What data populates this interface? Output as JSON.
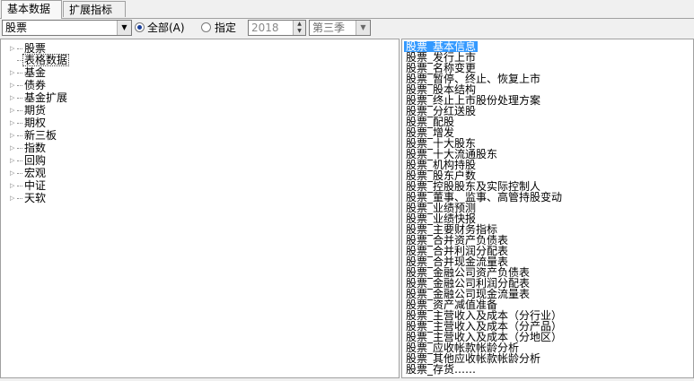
{
  "tabs": [
    {
      "label": "基本数据",
      "active": true
    },
    {
      "label": "扩展指标",
      "active": false
    }
  ],
  "toolbar": {
    "type_value": "股票",
    "radio_all_label": "全部(A)",
    "radio_spec_label": "指定",
    "year_value": "2018",
    "season_value": "第三季"
  },
  "tree": {
    "items": [
      {
        "label": "股票"
      },
      {
        "label": "表格数据",
        "selected": true
      },
      {
        "label": "基金"
      },
      {
        "label": "债券"
      },
      {
        "label": "基金扩展"
      },
      {
        "label": "期货"
      },
      {
        "label": "期权"
      },
      {
        "label": "新三板"
      },
      {
        "label": "指数"
      },
      {
        "label": "回购"
      },
      {
        "label": "宏观"
      },
      {
        "label": "中证"
      },
      {
        "label": "天软"
      }
    ]
  },
  "list": {
    "items": [
      "股票_基本信息",
      "股票_发行上市",
      "股票_名称变更",
      "股票_暂停、终止、恢复上市",
      "股票_股本结构",
      "股票_终止上市股份处理方案",
      "股票_分红送股",
      "股票_配股",
      "股票_增发",
      "股票_十大股东",
      "股票_十大流通股东",
      "股票_机构持股",
      "股票_股东户数",
      "股票_控股股东及实际控制人",
      "股票_董事、监事、高管持股变动",
      "股票_业绩预测",
      "股票_业绩快报",
      "股票_主要财务指标",
      "股票_合并资产负债表",
      "股票_合并利润分配表",
      "股票_合并现金流量表",
      "股票_金融公司资产负债表",
      "股票_金融公司利润分配表",
      "股票_金融公司现金流量表",
      "股票_资产减值准备",
      "股票_主营收入及成本（分行业）",
      "股票_主营收入及成本（分产品）",
      "股票_主营收入及成本（分地区）",
      "股票_应收帐款帐龄分析",
      "股票_其他应收帐款帐龄分析",
      "股票_存货……"
    ]
  },
  "colors": {
    "selection": "#3399ff",
    "background": "#f0f0f0"
  }
}
